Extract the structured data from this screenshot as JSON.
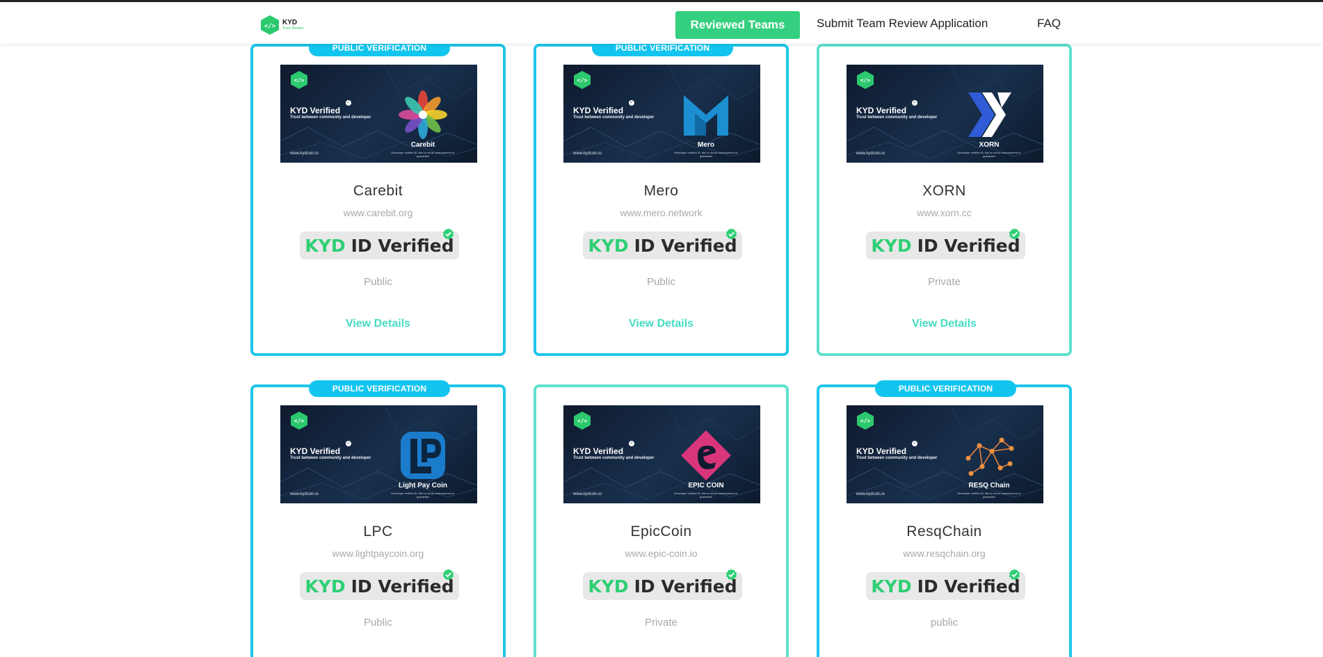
{
  "header": {
    "logo_main": "KYD",
    "logo_sub": "Team Review",
    "nav_reviewed": "Reviewed Teams",
    "nav_submit": "Submit Team Review Application",
    "nav_faq": "FAQ",
    "accent": "#35d07f"
  },
  "banner_common": {
    "title": "KYD Verified",
    "tagline": "Trust between community and developer",
    "url": "www.kydcoin.io",
    "note": "Developer verified ID.\nthis is not an endorsement or guarantee"
  },
  "badge": {
    "kyd": "KYD",
    "rest": "ID Verified"
  },
  "ribbon_label": "PUBLIC VERIFICATION",
  "details_label": "View Details",
  "colors": {
    "public_border": "#1ec6ea",
    "private_border": "#5ee0cc",
    "details": "#45dcc3"
  },
  "cards": [
    {
      "name": "Carebit",
      "banner_name": "Carebit",
      "site": "www.carebit.org",
      "visibility": "Public",
      "ribbon": true
    },
    {
      "name": "Mero",
      "banner_name": "Mero",
      "site": "www.mero.network",
      "visibility": "Public",
      "ribbon": true
    },
    {
      "name": "XORN",
      "banner_name": "XORN",
      "site": "www.xorn.cc",
      "visibility": "Private",
      "ribbon": false
    },
    {
      "name": "LPC",
      "banner_name": "Light Pay Coin",
      "site": "www.lightpaycoin.org",
      "visibility": "Public",
      "ribbon": true
    },
    {
      "name": "EpicCoin",
      "banner_name": "EPIC COIN",
      "site": "www.epic-coin.io",
      "visibility": "Private",
      "ribbon": false
    },
    {
      "name": "ResqChain",
      "banner_name": "RESQ Chain",
      "site": "www.resqchain.org",
      "visibility": "public",
      "ribbon": true
    }
  ]
}
